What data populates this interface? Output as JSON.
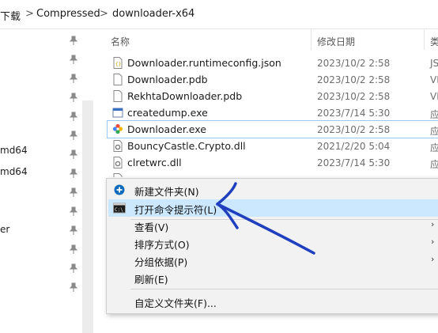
{
  "breadcrumb": {
    "items": [
      "下载",
      "Compressed",
      "downloader-x64"
    ],
    "separator": ">"
  },
  "nav": {
    "items": [
      "md64",
      "md64",
      "er"
    ]
  },
  "columns": {
    "name": "名称",
    "date": "修改日期",
    "type": "类"
  },
  "files": [
    {
      "name": "",
      "date": "",
      "type": ""
    },
    {
      "name": "Downloader.runtimeconfig.json",
      "date": "2023/10/2 2:58",
      "type": "JS",
      "icon": "json-file-icon"
    },
    {
      "name": "Downloader.pdb",
      "date": "2023/10/2 2:58",
      "type": "VI",
      "icon": "file-icon"
    },
    {
      "name": "RekhtaDownloader.pdb",
      "date": "2023/10/2 2:58",
      "type": "VI",
      "icon": "file-icon"
    },
    {
      "name": "createdump.exe",
      "date": "2023/7/14 5:30",
      "type": "应",
      "icon": "exe-window-icon"
    },
    {
      "name": "Downloader.exe",
      "date": "2023/10/2 2:58",
      "type": "应",
      "icon": "app-flower-icon"
    },
    {
      "name": "BouncyCastle.Crypto.dll",
      "date": "2021/2/20 5:04",
      "type": "应",
      "icon": "dll-gear-icon"
    },
    {
      "name": "clretwrc.dll",
      "date": "2023/7/14 5:30",
      "type": "应",
      "icon": "dll-gear-icon"
    }
  ],
  "context_menu": {
    "items": [
      {
        "label": "新建文件夹(N)",
        "icon": "new-folder-icon",
        "submenu": false
      },
      {
        "label": "打开命令提示符(L)",
        "icon": "cmd-icon",
        "submenu": false,
        "highlighted": true
      },
      {
        "label": "查看(V)",
        "submenu": true
      },
      {
        "label": "排序方式(O)",
        "submenu": true
      },
      {
        "label": "分组依据(P)",
        "submenu": true
      },
      {
        "label": "刷新(E)",
        "submenu": false
      },
      {
        "label": "自定义文件夹(F)...",
        "submenu": false
      }
    ],
    "submenu_arrow": "›"
  },
  "colors": {
    "highlight": "#cce8ff",
    "annotation_stroke": "#1f3fbf"
  }
}
